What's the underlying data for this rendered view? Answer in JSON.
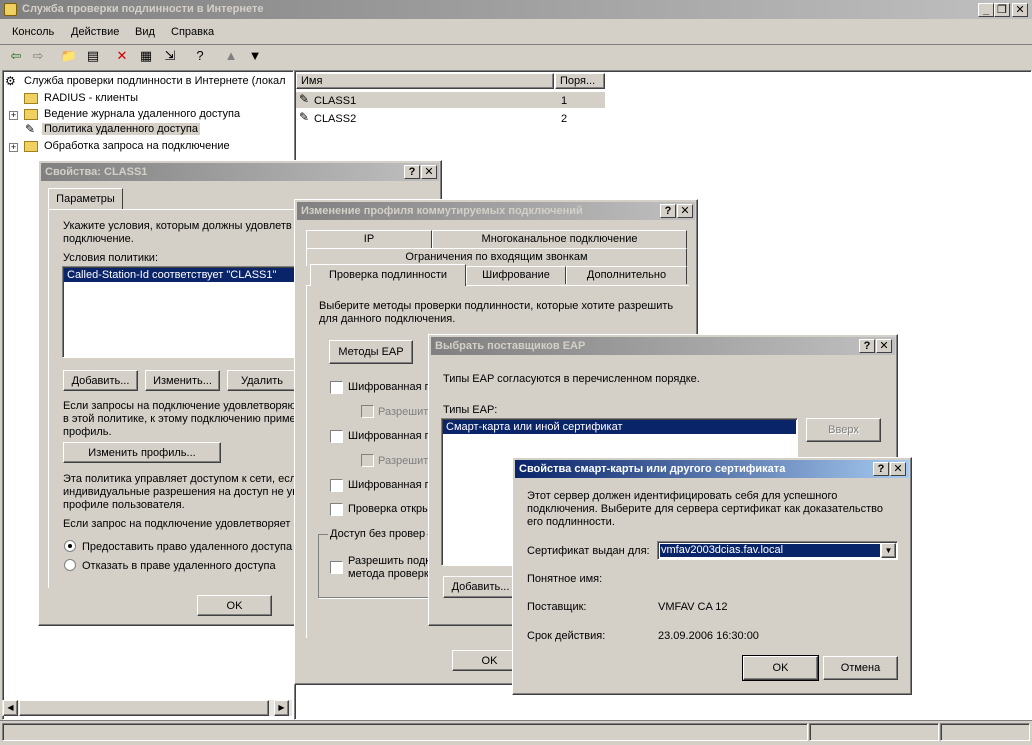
{
  "main": {
    "title": "Служба проверки подлинности в Интернете",
    "menu": [
      "Консоль",
      "Действие",
      "Вид",
      "Справка"
    ],
    "toolbar_icons": [
      "back-icon",
      "forward-icon",
      "up-folder-icon",
      "show-tree-icon",
      "delete-icon",
      "properties-icon",
      "export-icon",
      "help-icon",
      "move-up-icon",
      "move-down-icon"
    ],
    "tree": {
      "root": "Служба проверки подлинности в Интернете (локал",
      "items": [
        "RADIUS - клиенты",
        "Ведение журнала удаленного доступа",
        "Политика удаленного доступа",
        "Обработка запроса на подключение"
      ]
    },
    "list": {
      "columns": [
        "Имя",
        "Поря..."
      ],
      "rows": [
        {
          "name": "CLASS1",
          "order": "1"
        },
        {
          "name": "CLASS2",
          "order": "2"
        }
      ]
    }
  },
  "props_class1": {
    "title": "Свойства: CLASS1",
    "tab": "Параметры",
    "intro": "Укажите условия, которым должны удовлетв",
    "intro2": "подключение.",
    "conditions_label": "Условия политики:",
    "condition": "Called-Station-Id соответствует \"CLASS1\"",
    "add": "Добавить...",
    "edit": "Изменить...",
    "remove": "Удалить",
    "match1": "Если запросы на подключение удовлетворяю",
    "match2": "в этой политике, к этому подключению применя",
    "match3": "профиль.",
    "edit_profile": "Изменить профиль...",
    "policy1": "Эта политика управляет доступом к сети, есл",
    "policy2": "индивидуальные разрешения на доступ не ук",
    "policy3": "профиле пользователя.",
    "if_request": "Если запрос на подключение удовлетворяет",
    "grant": "Предоставить право удаленного доступа",
    "deny": "Отказать в праве удаленного доступа",
    "ok": "OK"
  },
  "profile": {
    "title": "Изменение профиля коммутируемых подключений",
    "tabs_row1": [
      "IP",
      "Многоканальное подключение"
    ],
    "tabs_row2": [
      "Ограничения по входящим звонкам"
    ],
    "tabs_row3": [
      "Проверка подлинности",
      "Шифрование",
      "Дополнительно"
    ],
    "desc1": "Выберите методы проверки подлинности, которые хотите разрешить",
    "desc2": "для данного подключения.",
    "eap_methods": "Методы EAP",
    "enc1": "Шифрованная п",
    "allow1": "Разрешить",
    "enc2": "Шифрованная п",
    "allow2": "Разрешить",
    "enc3": "Шифрованная п",
    "plain": "Проверка откры",
    "unauth_group": "Доступ без провер",
    "allow_conn1": "Разрешить подк",
    "allow_conn2": "метода проверк",
    "ok": "OK"
  },
  "eap": {
    "title": "Выбрать поставщиков EAP",
    "desc": "Типы EAP согласуются в перечисленном порядке.",
    "types_label": "Типы EAP:",
    "item": "Смарт-карта или иной сертификат",
    "up": "Вверх",
    "add": "Добавить..."
  },
  "cert": {
    "title": "Свойства смарт-карты или другого сертификата",
    "desc1": "Этот сервер должен идентифицировать себя для успешного",
    "desc2": "подключения. Выберите для сервера сертификат как доказательство",
    "desc3": "его подлинности.",
    "issued_label": "Сертификат выдан для:",
    "issued_value": "vmfav2003dcias.fav.local",
    "friendly_label": "Понятное имя:",
    "friendly_value": "",
    "issuer_label": "Поставщик:",
    "issuer_value": "VMFAV CA 12",
    "expiry_label": "Срок действия:",
    "expiry_value": "23.09.2006 16:30:00",
    "ok": "OK",
    "cancel": "Отмена"
  }
}
